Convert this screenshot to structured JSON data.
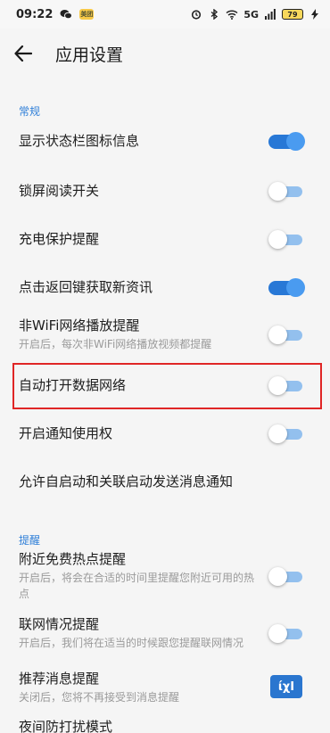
{
  "status_bar": {
    "time": "09:22",
    "app_badge": "美团",
    "network": "5G",
    "battery": "79"
  },
  "header": {
    "title": "应用设置"
  },
  "sections": {
    "general": {
      "title": "常规"
    },
    "reminders": {
      "title": "提醒"
    }
  },
  "rows": [
    {
      "label": "显示状态栏图标信息",
      "sub": "",
      "toggle": "on"
    },
    {
      "label": "锁屏阅读开关",
      "sub": "",
      "toggle": "off"
    },
    {
      "label": "充电保护提醒",
      "sub": "",
      "toggle": "off"
    },
    {
      "label": "点击返回键获取新资讯",
      "sub": "",
      "toggle": "on"
    },
    {
      "label": "非WiFi网络播放提醒",
      "sub": "开启后，每次非WiFi网络播放视频都提醒",
      "toggle": "off"
    },
    {
      "label": "自动打开数据网络",
      "sub": "",
      "toggle": "off"
    },
    {
      "label": "开启通知使用权",
      "sub": "",
      "toggle": "off"
    },
    {
      "label": "允许自启动和关联启动发送消息通知",
      "sub": "",
      "toggle": ""
    },
    {
      "label": "附近免费热点提醒",
      "sub": "开启后，将会在合适的时间里提醒您附近可用的热点",
      "toggle": "off"
    },
    {
      "label": "联网情况提醒",
      "sub": "开启后，我们将在适当的时候跟您提醒联网情况",
      "toggle": "off"
    },
    {
      "label": "推荐消息提醒",
      "sub": "关闭后，您将不再接受到消息提醒",
      "toggle": "off"
    },
    {
      "label": "夜间防打扰模式",
      "sub": "",
      "toggle": ""
    }
  ],
  "watermark": "ίχΙ",
  "colors": {
    "accent": "#2f7fd8",
    "toggle_on": "#2878d6",
    "toggle_off_track": "#93c0ee",
    "highlight": "#e02626"
  }
}
